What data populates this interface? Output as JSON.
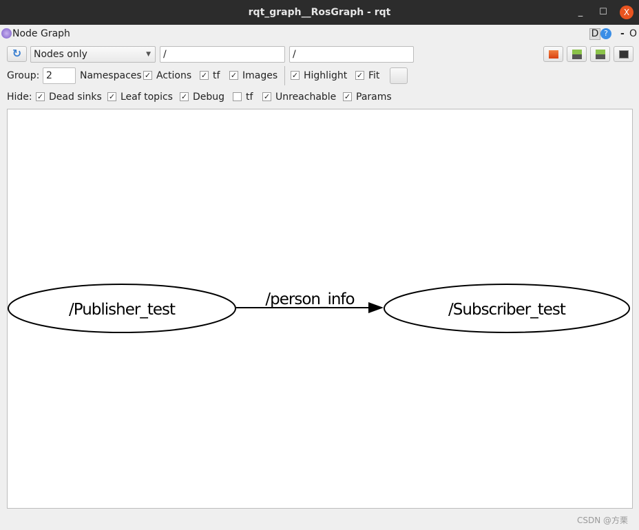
{
  "window": {
    "title": "rqt_graph__RosGraph - rqt",
    "minimize": "_",
    "maximize": "☐",
    "close": "X"
  },
  "plugin": {
    "title": "Node Graph",
    "d_label": "D",
    "help": "?",
    "dash": "-",
    "o": "O"
  },
  "toolbar": {
    "mode": "Nodes only",
    "node_filter": "/",
    "topic_filter": "/"
  },
  "options": {
    "group_label": "Group:",
    "group_value": "2",
    "items": [
      {
        "label": "Namespaces",
        "checked": true
      },
      {
        "label": "Actions",
        "checked": true
      },
      {
        "label": "tf",
        "checked": true
      },
      {
        "label": "Images",
        "checked": true
      },
      {
        "label": "Highlight",
        "checked": true
      },
      {
        "label": "Fit",
        "checked": true
      }
    ]
  },
  "hide": {
    "label": "Hide:",
    "items": [
      {
        "label": "Dead sinks",
        "checked": true
      },
      {
        "label": "Leaf topics",
        "checked": true
      },
      {
        "label": "Debug",
        "checked": true
      },
      {
        "label": "tf",
        "checked": false
      },
      {
        "label": "Unreachable",
        "checked": true
      },
      {
        "label": "Params",
        "checked": true
      }
    ]
  },
  "graph": {
    "nodes": [
      "/Publisher_test",
      "/Subscriber_test"
    ],
    "edge_label": "/person_info"
  },
  "watermark": "CSDN @方栗"
}
